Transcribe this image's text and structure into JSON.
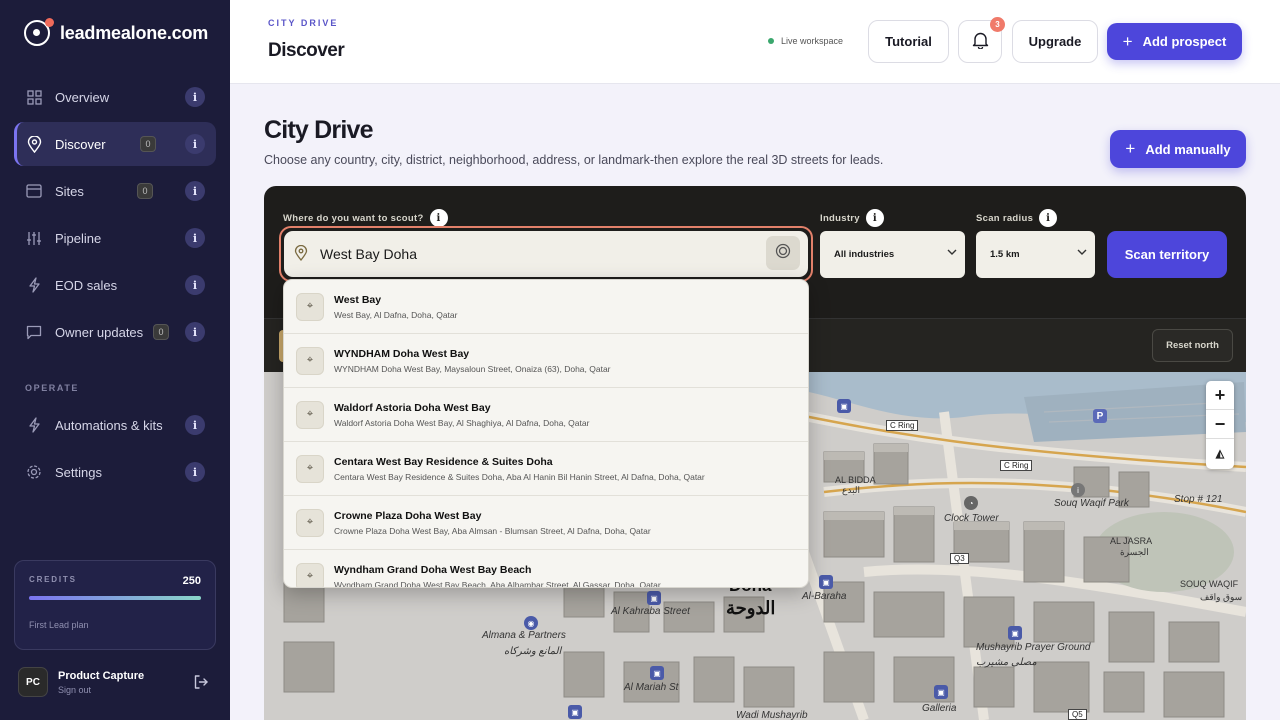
{
  "brand": {
    "name": "leadmealone.com"
  },
  "sidebar": {
    "items": [
      {
        "label": "Overview",
        "icon": "grid-icon",
        "count": null
      },
      {
        "label": "Discover",
        "icon": "map-pin-icon",
        "count": "0"
      },
      {
        "label": "Sites",
        "icon": "browser-window-icon",
        "count": "0"
      },
      {
        "label": "Pipeline",
        "icon": "sliders-icon",
        "count": null
      },
      {
        "label": "EOD sales",
        "icon": "lightning-icon",
        "count": null
      },
      {
        "label": "Owner updates",
        "icon": "message-icon",
        "count": "0"
      }
    ],
    "section_label": "OPERATE",
    "operate_items": [
      {
        "label": "Automations & kits",
        "icon": "lightning-icon"
      },
      {
        "label": "Settings",
        "icon": "gear-icon"
      }
    ],
    "info_glyph": "i",
    "credits": {
      "label": "CREDITS",
      "value": "250",
      "plan": "First Lead plan",
      "fill": 1.0
    },
    "user": {
      "initials": "PC",
      "name": "Product Capture",
      "action": "Sign out"
    }
  },
  "header": {
    "eyebrow": "CITY DRIVE",
    "title": "Discover",
    "status": "Live workspace",
    "tutorial": "Tutorial",
    "notifications": "3",
    "upgrade": "Upgrade",
    "add_prospect": "Add prospect"
  },
  "main": {
    "title": "City Drive",
    "description": "Choose any country, city, district, neighborhood, address, or landmark-then explore the real 3D streets for leads.",
    "add_manually": "Add manually"
  },
  "search": {
    "label": "Where do you want to scout?",
    "value": "West Bay Doha",
    "industry_label": "Industry",
    "industry_value": "All industries",
    "radius_label": "Scan radius",
    "radius_value": "1.5 km",
    "scan_button": "Scan territory",
    "reset_north": "Reset north"
  },
  "suggestions": [
    {
      "title": "West Bay",
      "subtitle": "West Bay, Al Dafna, Doha, Qatar"
    },
    {
      "title": "WYNDHAM Doha West Bay",
      "subtitle": "WYNDHAM Doha West Bay, Maysaloun Street, Onaiza (63), Doha, Qatar"
    },
    {
      "title": "Waldorf Astoria Doha West Bay",
      "subtitle": "Waldorf Astoria Doha West Bay, Al Shaghiya, Al Dafna, Doha, Qatar"
    },
    {
      "title": "Centara West Bay Residence & Suites Doha",
      "subtitle": "Centara West Bay Residence & Suites Doha, Aba Al Hanin Bil Hanin Street, Al Dafna, Doha, Qatar"
    },
    {
      "title": "Crowne Plaza Doha West Bay",
      "subtitle": "Crowne Plaza Doha West Bay, Aba Almsan - Blumsan Street, Al Dafna, Doha, Qatar"
    },
    {
      "title": "Wyndham Grand Doha West Bay Beach",
      "subtitle": "Wyndham Grand Doha West Bay Beach, Aba Alhambar Street, Al Gassar, Doha, Qatar"
    }
  ],
  "map": {
    "labels": {
      "doha": "Doha",
      "doha_ar": "الدوحة",
      "al_bidda": "AL BIDDA",
      "al_bidda_ar": "البدع",
      "clock_tower": "Clock Tower",
      "souq_waqif": "Souq Waqif Park",
      "stop": "Stop # 121",
      "al_jasra": "AL JASRA",
      "al_jasra_ar": "الجسرة",
      "souq_waqif_caps": "SOUQ WAQIF",
      "souq_waqif_ar": "سوق واقف",
      "al_baraha": "Al-Baraha",
      "al_kahraba": "Al Kahraba Street",
      "almana": "Almana & Partners",
      "al_mariah": "Al Mariah St",
      "mushayrib_prayer": "Mushayrib Prayer Ground",
      "mushayrib_prayer_ar": "مصلى مشيرب",
      "galleria": "Galleria",
      "wadi_mushayrib": "Wadi Mushayrib",
      "almana_ar": "المانع وشركاه"
    },
    "roads": {
      "c_ring_1": "C Ring",
      "c_ring_2": "C Ring",
      "q3": "Q3",
      "q5": "Q5"
    },
    "controls": {
      "zoom_in": "+",
      "zoom_out": "−",
      "compass": "◭"
    }
  }
}
